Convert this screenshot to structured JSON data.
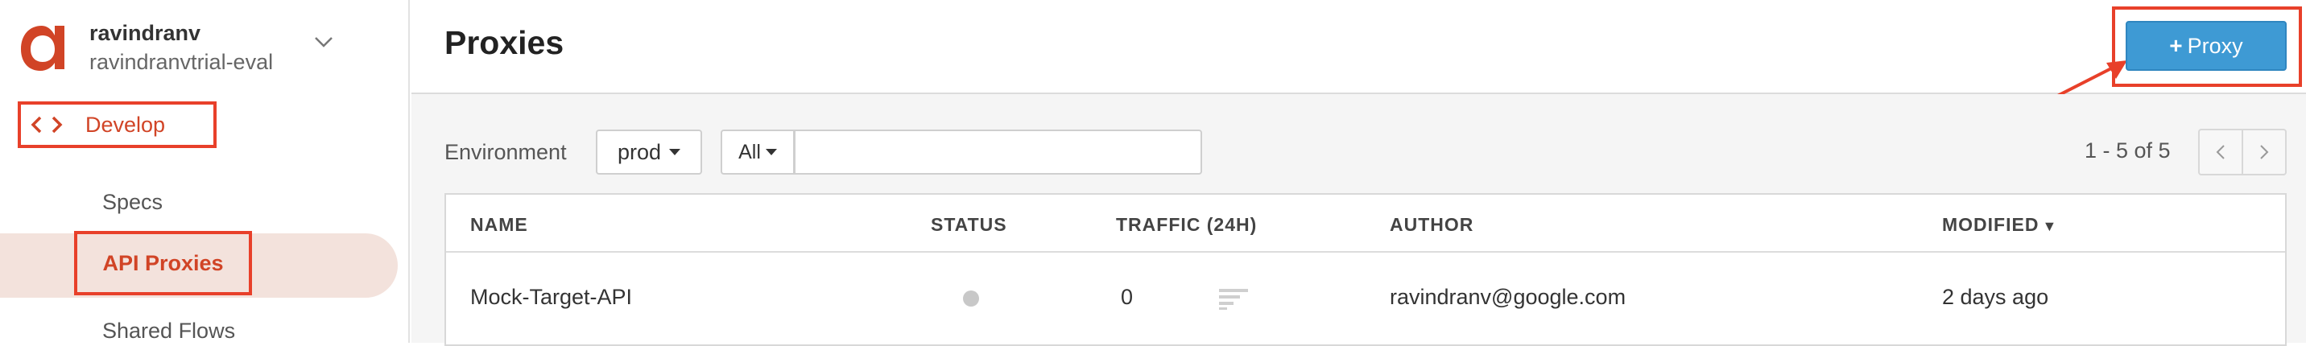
{
  "sidebar": {
    "org_user": "ravindranv",
    "org_name": "ravindranvtrial-eval",
    "develop_label": "Develop",
    "items": [
      {
        "label": "Specs"
      },
      {
        "label": "API Proxies",
        "active": true
      },
      {
        "label": "Shared Flows"
      }
    ]
  },
  "header": {
    "title": "Proxies",
    "add_button_label": "Proxy"
  },
  "filters": {
    "environment_label": "Environment",
    "environment_value": "prod",
    "scope_value": "All",
    "search_value": ""
  },
  "pager": {
    "range_text": "1 - 5 of 5"
  },
  "table": {
    "columns": [
      "NAME",
      "STATUS",
      "TRAFFIC (24H)",
      "AUTHOR",
      "MODIFIED"
    ],
    "sort_indicator": "▼",
    "rows": [
      {
        "name": "Mock-Target-API",
        "traffic": "0",
        "author": "ravindranv@google.com",
        "modified": "2 days ago"
      }
    ]
  },
  "colors": {
    "brand": "#d14426",
    "highlight_box": "#e8402a",
    "primary_button": "#3e9ad4",
    "active_nav_bg": "#f3e2dc"
  },
  "icons": {
    "logo": "apigee-logo-icon",
    "develop": "code-brackets-icon",
    "org_switch": "chevron-down-icon",
    "add": "plus-icon",
    "prev": "chevron-left-icon",
    "next": "chevron-right-icon",
    "traffic": "traffic-bars-icon"
  }
}
